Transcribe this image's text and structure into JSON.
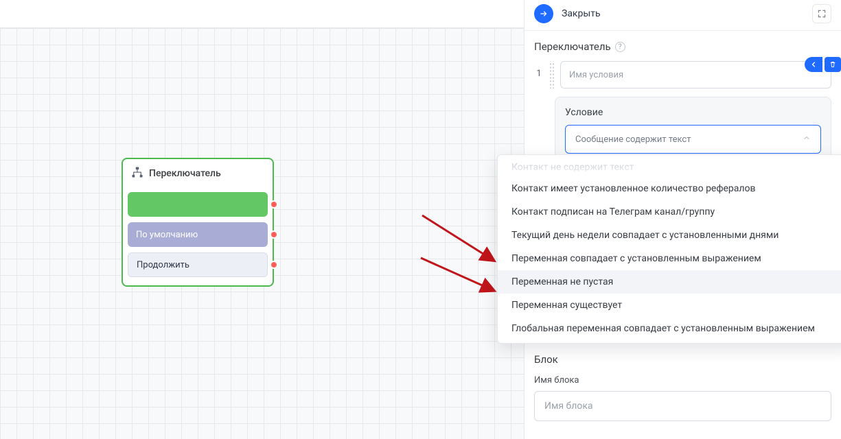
{
  "node": {
    "title": "Переключатель",
    "rows": {
      "default": "По умолчанию",
      "continue": "Продолжить"
    }
  },
  "panel": {
    "close": "Закрыть",
    "title": "Переключатель",
    "condition": {
      "index": "1",
      "placeholder": "Имя условия",
      "card_label": "Условие",
      "select_value": "Сообщение содержит текст"
    },
    "dropdown": {
      "cut": "Контакт не содержит текст",
      "items": [
        "Контакт имеет установленное количество рефералов",
        "Контакт подписан на Телеграм канал/группу",
        "Текущий день недели совпадает с установленными днями",
        "Переменная совпадает с установленным выражением",
        "Переменная не пустая",
        "Переменная существует",
        "Глобальная переменная совпадает с установленным выражением"
      ]
    },
    "block": {
      "title": "Блок",
      "label": "Имя блока",
      "placeholder": "Имя блока"
    }
  }
}
